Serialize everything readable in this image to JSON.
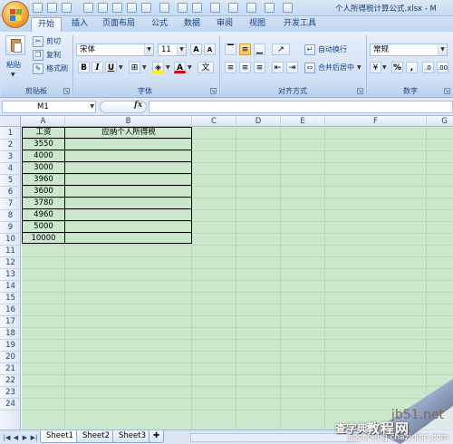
{
  "window": {
    "title": "个人所得税计算公式.xlsx - M"
  },
  "tabs": [
    {
      "label": "开始",
      "active": true
    },
    {
      "label": "插入"
    },
    {
      "label": "页面布局"
    },
    {
      "label": "公式"
    },
    {
      "label": "数据"
    },
    {
      "label": "审阅"
    },
    {
      "label": "视图"
    },
    {
      "label": "开发工具"
    }
  ],
  "ribbon": {
    "clipboard": {
      "paste": "粘贴",
      "cut": "剪切",
      "copy": "复制",
      "format_painter": "格式刷",
      "label": "剪贴板"
    },
    "font": {
      "name": "宋体",
      "size": "11",
      "bold": "B",
      "italic": "I",
      "underline": "U",
      "label": "字体"
    },
    "alignment": {
      "wrap": "自动换行",
      "merge": "合并后居中",
      "label": "对齐方式"
    },
    "number": {
      "format": "常规",
      "currency": "",
      "percent": "%",
      "comma": ",",
      "label": "数字"
    }
  },
  "formula_bar": {
    "name_box": "M1",
    "fx": "fx",
    "content": ""
  },
  "columns": [
    "A",
    "B",
    "C",
    "D",
    "E",
    "F",
    "G"
  ],
  "rows": [
    "1",
    "2",
    "3",
    "4",
    "5",
    "6",
    "7",
    "8",
    "9",
    "10",
    "11",
    "12",
    "13",
    "14",
    "15",
    "16",
    "17",
    "18",
    "19",
    "20",
    "21",
    "22",
    "23",
    "24"
  ],
  "table": {
    "headers": [
      "工资",
      "应纳个人所得税"
    ],
    "salaries": [
      "3550",
      "4000",
      "3000",
      "3960",
      "3600",
      "3780",
      "4960",
      "5000",
      "10000"
    ]
  },
  "sheets": [
    {
      "name": "Sheet1",
      "active": true
    },
    {
      "name": "Sheet2"
    },
    {
      "name": "Sheet3"
    }
  ],
  "watermark": {
    "domain": "jb51.net",
    "tutorial": "教程网",
    "small": "查字典",
    "url": "jiaocheng.chazidian.com"
  },
  "colors": {
    "sheet_bg": "#cbe8cc",
    "ribbon": "#d2e1f4",
    "accent": "#15428b"
  }
}
